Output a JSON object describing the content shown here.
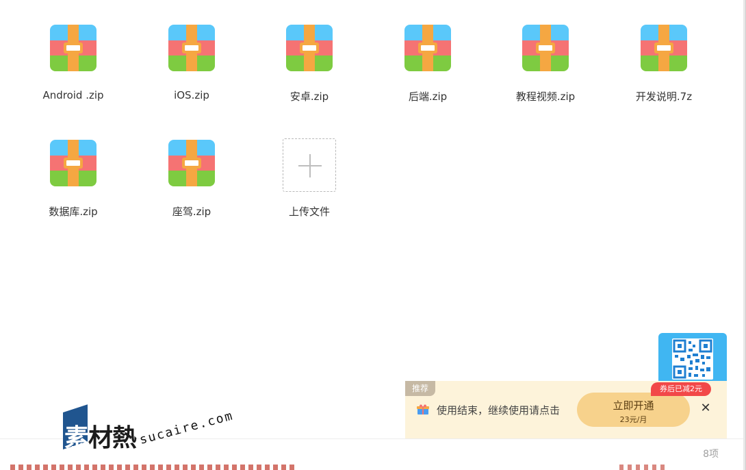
{
  "files": [
    {
      "name": "Android .zip",
      "icon": "zip-archive-icon"
    },
    {
      "name": "iOS.zip",
      "icon": "zip-archive-icon"
    },
    {
      "name": "安卓.zip",
      "icon": "zip-archive-icon"
    },
    {
      "name": "后端.zip",
      "icon": "zip-archive-icon"
    },
    {
      "name": "教程视频.zip",
      "icon": "zip-archive-icon"
    },
    {
      "name": "开发说明.7z",
      "icon": "zip-archive-icon"
    },
    {
      "name": "数据库.zip",
      "icon": "zip-archive-icon"
    },
    {
      "name": "座驾.zip",
      "icon": "zip-archive-icon"
    }
  ],
  "upload": {
    "label": "上传文件",
    "icon": "plus-icon"
  },
  "footer": {
    "item_count": "8项"
  },
  "promo": {
    "tag": "推荐",
    "message": "使用结束，继续使用请点击",
    "cta_main": "立即开通",
    "cta_sub": "23元/月",
    "coupon": "券后已减2元",
    "close_glyph": "✕"
  },
  "watermark": {
    "cn": "素材熱",
    "cn_first": "素",
    "cn_rest": "材熱",
    "en": "sucaire.com"
  },
  "colors": {
    "zip_blue": "#5ac8fa",
    "zip_red": "#f57373",
    "zip_green": "#7ecb41",
    "zip_strap": "#f5a742",
    "promo_bg": "#fdf3da",
    "cta_bg": "#f7d28c",
    "coupon_red": "#f24848",
    "qr_blue": "#40b6f2"
  }
}
